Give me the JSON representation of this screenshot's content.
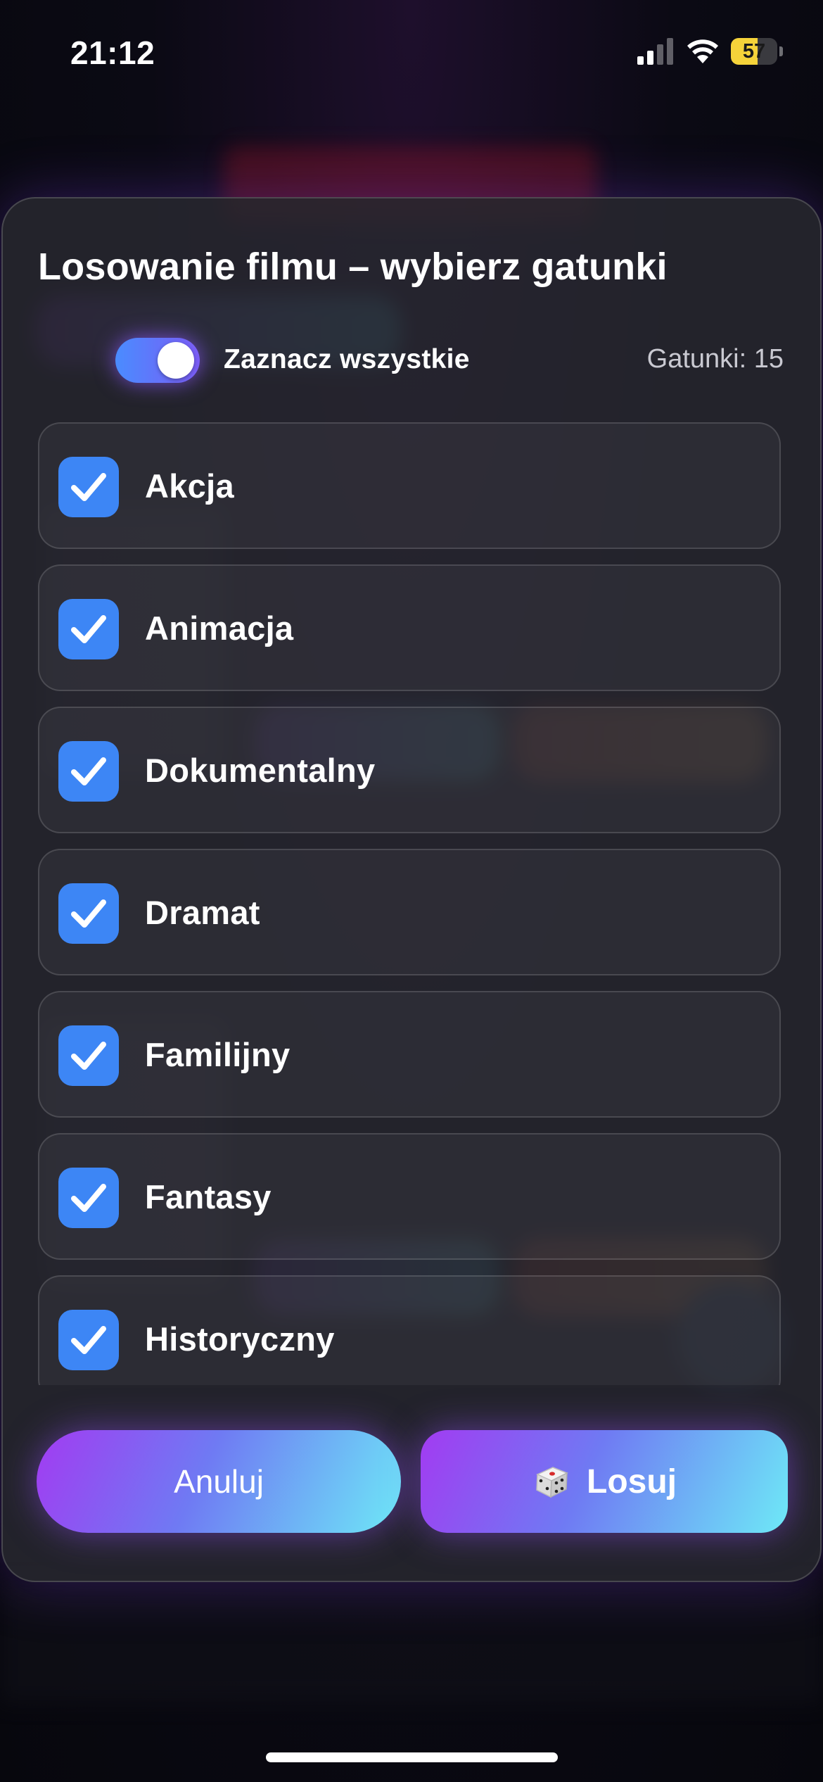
{
  "status_bar": {
    "time": "21:12",
    "battery_level": "57",
    "battery_percent": 57,
    "signal_bars": 2,
    "signal_bars_total": 4
  },
  "modal": {
    "title": "Losowanie filmu – wybierz gatunki",
    "select_all_label": "Zaznacz wszystkie",
    "select_all_on": true,
    "genre_count_label": "Gatunki: 15",
    "genres": [
      {
        "label": "Akcja",
        "checked": true
      },
      {
        "label": "Animacja",
        "checked": true
      },
      {
        "label": "Dokumentalny",
        "checked": true
      },
      {
        "label": "Dramat",
        "checked": true
      },
      {
        "label": "Familijny",
        "checked": true
      },
      {
        "label": "Fantasy",
        "checked": true
      },
      {
        "label": "Historyczny",
        "checked": true
      }
    ],
    "cancel_label": "Anuluj",
    "draw_label": "Losuj",
    "draw_icon": "dice-icon"
  },
  "colors": {
    "accent_purple": "#a23bf2",
    "accent_cyan": "#6ee9f7",
    "checkbox_blue": "#3d86f5",
    "battery_yellow": "#f5d33a"
  }
}
